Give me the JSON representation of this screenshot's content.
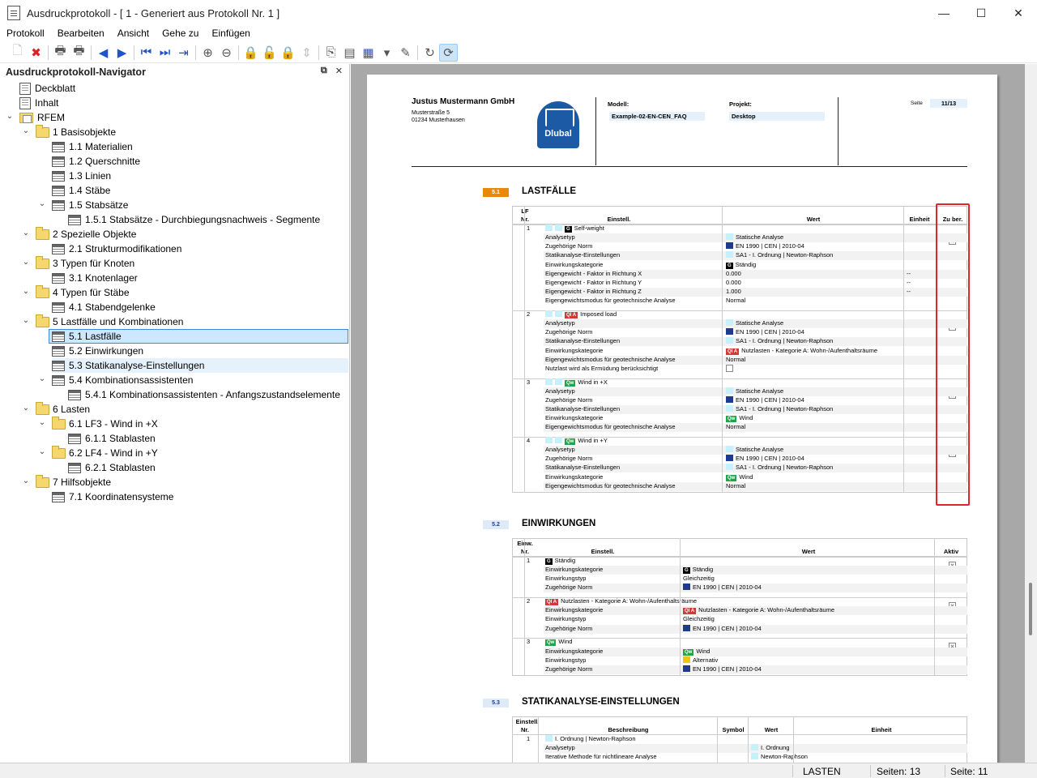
{
  "window": {
    "title": "Ausdruckprotokoll - [ 1 - Generiert aus Protokoll Nr. 1 ]",
    "controls": {
      "minimize": "—",
      "maximize": "☐",
      "close": "✕"
    }
  },
  "menu": [
    "Protokoll",
    "Bearbeiten",
    "Ansicht",
    "Gehe zu",
    "Einfügen"
  ],
  "toolbar": [
    {
      "name": "new-icon",
      "glyph": "🗋",
      "state": "dis"
    },
    {
      "name": "delete-icon",
      "glyph": "✖",
      "state": "red"
    },
    {
      "name": "print-icon",
      "glyph": "🖶",
      "state": ""
    },
    {
      "name": "print-setup-icon",
      "glyph": "🖶",
      "state": ""
    },
    {
      "name": "previous-icon",
      "glyph": "◀",
      "state": "blue"
    },
    {
      "name": "next-icon",
      "glyph": "▶",
      "state": "blue"
    },
    {
      "name": "first-icon",
      "glyph": "⏮",
      "state": "blue"
    },
    {
      "name": "last-icon",
      "glyph": "⏭",
      "state": "blue"
    },
    {
      "name": "goto-page-icon",
      "glyph": "⇥",
      "state": "blue"
    },
    {
      "name": "zoom-in-icon",
      "glyph": "⊕",
      "state": ""
    },
    {
      "name": "zoom-out-icon",
      "glyph": "⊖",
      "state": ""
    },
    {
      "name": "lock-icon",
      "glyph": "🔒",
      "state": "dis"
    },
    {
      "name": "unlock-icon",
      "glyph": "🔓",
      "state": "dis"
    },
    {
      "name": "lock-all-icon",
      "glyph": "🔒",
      "state": "dis"
    },
    {
      "name": "arrange-icon",
      "glyph": "⇕",
      "state": "dis"
    },
    {
      "name": "page-setup-icon",
      "glyph": "⎘",
      "state": ""
    },
    {
      "name": "header-icon",
      "glyph": "▤",
      "state": ""
    },
    {
      "name": "settings-icon",
      "glyph": "▦",
      "state": "blue"
    },
    {
      "name": "dropdown-icon",
      "glyph": "▾",
      "state": ""
    },
    {
      "name": "edit-icon",
      "glyph": "✎",
      "state": ""
    },
    {
      "name": "refresh-icon",
      "glyph": "↻",
      "state": ""
    },
    {
      "name": "auto-update-icon",
      "glyph": "⟳",
      "state": "sel"
    }
  ],
  "navigator": {
    "title": "Ausdruckprotokoll-Navigator",
    "pin_glyph": "⧉",
    "close_glyph": "✕",
    "items": [
      {
        "label": "Deckblatt",
        "icon": "page",
        "level": 0,
        "chevron": ""
      },
      {
        "label": "Inhalt",
        "icon": "page",
        "level": 0,
        "chevron": ""
      },
      {
        "label": "RFEM",
        "icon": "rfem",
        "level": 0,
        "chevron": "⌄"
      },
      {
        "label": "1 Basisobjekte",
        "icon": "folder",
        "level": 1,
        "chevron": "⌄"
      },
      {
        "label": "1.1 Materialien",
        "icon": "table",
        "level": 2,
        "chevron": ""
      },
      {
        "label": "1.2 Querschnitte",
        "icon": "table",
        "level": 2,
        "chevron": ""
      },
      {
        "label": "1.3 Linien",
        "icon": "table",
        "level": 2,
        "chevron": ""
      },
      {
        "label": "1.4 Stäbe",
        "icon": "table",
        "level": 2,
        "chevron": ""
      },
      {
        "label": "1.5 Stabsätze",
        "icon": "table",
        "level": 2,
        "chevron": "⌄"
      },
      {
        "label": "1.5.1 Stabsätze - Durchbiegungsnachweis - Segmente",
        "icon": "table",
        "level": 3,
        "chevron": ""
      },
      {
        "label": "2 Spezielle Objekte",
        "icon": "folder",
        "level": 1,
        "chevron": "⌄"
      },
      {
        "label": "2.1 Strukturmodifikationen",
        "icon": "table",
        "level": 2,
        "chevron": ""
      },
      {
        "label": "3 Typen für Knoten",
        "icon": "folder",
        "level": 1,
        "chevron": "⌄"
      },
      {
        "label": "3.1 Knotenlager",
        "icon": "table",
        "level": 2,
        "chevron": ""
      },
      {
        "label": "4 Typen für Stäbe",
        "icon": "folder",
        "level": 1,
        "chevron": "⌄"
      },
      {
        "label": "4.1 Stabendgelenke",
        "icon": "table",
        "level": 2,
        "chevron": ""
      },
      {
        "label": "5 Lastfälle und Kombinationen",
        "icon": "folder",
        "level": 1,
        "chevron": "⌄"
      },
      {
        "label": "5.1 Lastfälle",
        "icon": "table",
        "level": 2,
        "chevron": "",
        "state": "selected"
      },
      {
        "label": "5.2 Einwirkungen",
        "icon": "table",
        "level": 2,
        "chevron": ""
      },
      {
        "label": "5.3 Statikanalyse-Einstellungen",
        "icon": "table",
        "level": 2,
        "chevron": "",
        "state": "hover"
      },
      {
        "label": "5.4 Kombinationsassistenten",
        "icon": "table",
        "level": 2,
        "chevron": "⌄"
      },
      {
        "label": "5.4.1 Kombinationsassistenten - Anfangszustandselemente",
        "icon": "table",
        "level": 3,
        "chevron": ""
      },
      {
        "label": "6 Lasten",
        "icon": "folder",
        "level": 1,
        "chevron": "⌄"
      },
      {
        "label": "6.1 LF3 - Wind in +X",
        "icon": "folder",
        "level": 2,
        "chevron": "⌄"
      },
      {
        "label": "6.1.1 Stablasten",
        "icon": "table",
        "level": 3,
        "chevron": ""
      },
      {
        "label": "6.2 LF4 - Wind in +Y",
        "icon": "folder",
        "level": 2,
        "chevron": "⌄"
      },
      {
        "label": "6.2.1 Stablasten",
        "icon": "table",
        "level": 3,
        "chevron": ""
      },
      {
        "label": "7 Hilfsobjekte",
        "icon": "folder",
        "level": 1,
        "chevron": "⌄"
      },
      {
        "label": "7.1 Koordinatensysteme",
        "icon": "table",
        "level": 2,
        "chevron": ""
      }
    ]
  },
  "page": {
    "company": "Justus Mustermann GmbH",
    "street": "Musterstraße 5",
    "city": "01234 Musterhausen",
    "logo_text": "Dlubal",
    "model_label": "Modell:",
    "model_value": "Example-02-EN-CEN_FAQ",
    "project_label": "Projekt:",
    "project_value": "Desktop",
    "page_label": "Seite",
    "page_value": "11/13",
    "sections": [
      {
        "num": "5.1",
        "title": "LASTFÄLLE"
      },
      {
        "num": "5.2",
        "title": "EINWIRKUNGEN"
      },
      {
        "num": "5.3",
        "title": "STATIKANALYSE-EINSTELLUNGEN"
      }
    ],
    "lastfaelle": {
      "headers": {
        "nr_1": "LF",
        "nr_2": "Nr.",
        "einstell": "Einstell.",
        "wert": "Wert",
        "einheit": "Einheit",
        "zuber": "Zu ber."
      },
      "cases": [
        {
          "nr": "1",
          "badge": "G",
          "badge_color": "g",
          "name": "Self-weight",
          "checked": true,
          "rows": [
            {
              "label": "Analysetyp",
              "value": "Statische Analyse",
              "marker": "cyan",
              "unit": ""
            },
            {
              "label": "Zugehörige Norm",
              "value": "EN 1990 | CEN | 2010-04",
              "marker": "navy",
              "unit": ""
            },
            {
              "label": "Statikanalyse-Einstellungen",
              "value": "SA1 - I. Ordnung | Newton-Raphson",
              "marker": "cyan",
              "unit": ""
            },
            {
              "label": "Einwirkungskategorie",
              "value": "Ständig",
              "marker": "badge-g",
              "unit": ""
            },
            {
              "label": "Eigengewicht - Faktor in Richtung X",
              "value": "0.000",
              "marker": "",
              "unit": "--"
            },
            {
              "label": "Eigengewicht - Faktor in Richtung Y",
              "value": "0.000",
              "marker": "",
              "unit": "--"
            },
            {
              "label": "Eigengewicht - Faktor in Richtung Z",
              "value": "1.000",
              "marker": "",
              "unit": "--"
            },
            {
              "label": "Eigengewichtsmodus für geotechnische Analyse",
              "value": "Normal",
              "marker": "",
              "unit": ""
            }
          ]
        },
        {
          "nr": "2",
          "badge": "QI A",
          "badge_color": "q",
          "name": "Imposed load",
          "checked": false,
          "rows": [
            {
              "label": "Analysetyp",
              "value": "Statische Analyse",
              "marker": "cyan",
              "unit": ""
            },
            {
              "label": "Zugehörige Norm",
              "value": "EN 1990 | CEN | 2010-04",
              "marker": "navy",
              "unit": ""
            },
            {
              "label": "Statikanalyse-Einstellungen",
              "value": "SA1 - I. Ordnung | Newton-Raphson",
              "marker": "cyan",
              "unit": ""
            },
            {
              "label": "Einwirkungskategorie",
              "value": "Nutzlasten - Kategorie A: Wohn-/Aufenthaltsräume",
              "marker": "badge-q",
              "unit": ""
            },
            {
              "label": "Eigengewichtsmodus für geotechnische Analyse",
              "value": "Normal",
              "marker": "",
              "unit": ""
            },
            {
              "label": "Nutzlast wird als Ermüdung berücksichtigt",
              "value": "",
              "marker": "checkbox",
              "unit": ""
            }
          ]
        },
        {
          "nr": "3",
          "badge": "Qw",
          "badge_color": "w",
          "name": "Wind in +X",
          "checked": true,
          "rows": [
            {
              "label": "Analysetyp",
              "value": "Statische Analyse",
              "marker": "cyan",
              "unit": ""
            },
            {
              "label": "Zugehörige Norm",
              "value": "EN 1990 | CEN | 2010-04",
              "marker": "navy",
              "unit": ""
            },
            {
              "label": "Statikanalyse-Einstellungen",
              "value": "SA1 - I. Ordnung | Newton-Raphson",
              "marker": "cyan",
              "unit": ""
            },
            {
              "label": "Einwirkungskategorie",
              "value": "Wind",
              "marker": "badge-w",
              "unit": ""
            },
            {
              "label": "Eigengewichtsmodus für geotechnische Analyse",
              "value": "Normal",
              "marker": "",
              "unit": ""
            }
          ]
        },
        {
          "nr": "4",
          "badge": "Qw",
          "badge_color": "w",
          "name": "Wind in +Y",
          "checked": true,
          "rows": [
            {
              "label": "Analysetyp",
              "value": "Statische Analyse",
              "marker": "cyan",
              "unit": ""
            },
            {
              "label": "Zugehörige Norm",
              "value": "EN 1990 | CEN | 2010-04",
              "marker": "navy",
              "unit": ""
            },
            {
              "label": "Statikanalyse-Einstellungen",
              "value": "SA1 - I. Ordnung | Newton-Raphson",
              "marker": "cyan",
              "unit": ""
            },
            {
              "label": "Einwirkungskategorie",
              "value": "Wind",
              "marker": "badge-w",
              "unit": ""
            },
            {
              "label": "Eigengewichtsmodus für geotechnische Analyse",
              "value": "Normal",
              "marker": "",
              "unit": ""
            }
          ]
        }
      ]
    },
    "einwirkungen": {
      "headers": {
        "nr_1": "Einw.",
        "nr_2": "Nr.",
        "einstell": "Einstell.",
        "wert": "Wert",
        "aktiv": "Aktiv"
      },
      "items": [
        {
          "nr": "1",
          "badge": "G",
          "badge_color": "g",
          "name": "Ständig",
          "checked": true,
          "rows": [
            {
              "label": "Einwirkungskategorie",
              "value": "Ständig",
              "marker": "badge-g"
            },
            {
              "label": "Einwirkungstyp",
              "value": "Gleichzeitig",
              "marker": ""
            },
            {
              "label": "Zugehörige Norm",
              "value": "EN 1990 | CEN | 2010-04",
              "marker": "navy"
            }
          ]
        },
        {
          "nr": "2",
          "badge": "QI A",
          "badge_color": "q",
          "name": "Nutzlasten - Kategorie A: Wohn-/Aufenthaltsräume",
          "checked": true,
          "rows": [
            {
              "label": "Einwirkungskategorie",
              "value": "Nutzlasten - Kategorie A: Wohn-/Aufenthaltsräume",
              "marker": "badge-q"
            },
            {
              "label": "Einwirkungstyp",
              "value": "Gleichzeitig",
              "marker": ""
            },
            {
              "label": "Zugehörige Norm",
              "value": "EN 1990 | CEN | 2010-04",
              "marker": "navy"
            }
          ]
        },
        {
          "nr": "3",
          "badge": "Qw",
          "badge_color": "w",
          "name": "Wind",
          "checked": true,
          "rows": [
            {
              "label": "Einwirkungskategorie",
              "value": "Wind",
              "marker": "badge-w"
            },
            {
              "label": "Einwirkungstyp",
              "value": "Alternativ",
              "marker": "yellow"
            },
            {
              "label": "Zugehörige Norm",
              "value": "EN 1990 | CEN | 2010-04",
              "marker": "navy"
            }
          ]
        }
      ]
    },
    "statik": {
      "headers": {
        "nr_1": "Einstell.",
        "nr_2": "Nr.",
        "beschreibung": "Beschreibung",
        "symbol": "Symbol",
        "wert": "Wert",
        "einheit": "Einheit"
      },
      "items": [
        {
          "nr": "1",
          "name": "I. Ordnung | Newton-Raphson",
          "rows": [
            {
              "label": "Analysetyp",
              "value": "I. Ordnung"
            },
            {
              "label": "Iterative Methode für nichtlineare Analyse",
              "value": "Newton-Raphson"
            }
          ]
        }
      ]
    }
  },
  "status": {
    "module": "LASTEN",
    "pages": "Seiten: 13",
    "page": "Seite: 11"
  },
  "colors": {
    "section_5_1": "#e8890c",
    "section_other": "#dfeaf7",
    "highlight": "#e0262a"
  }
}
